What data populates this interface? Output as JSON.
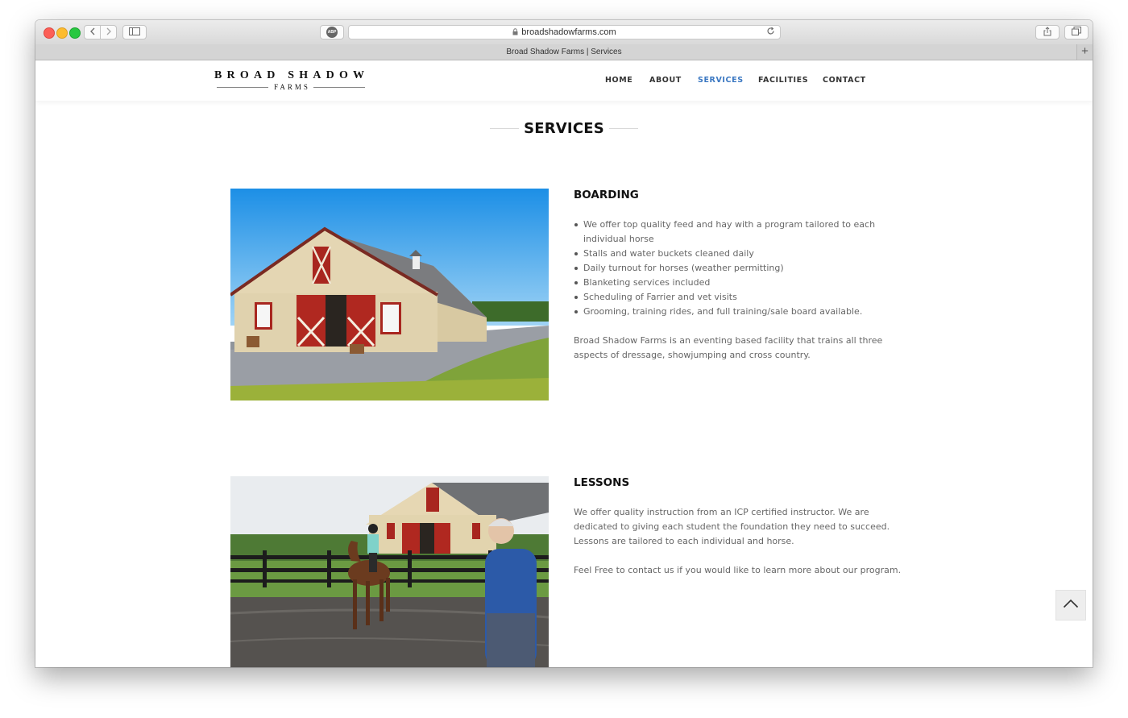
{
  "browser": {
    "url": "broadshadowfarms.com",
    "tab_title": "Broad Shadow Farms | Services",
    "abp_label": "ABP",
    "new_tab": "+"
  },
  "site": {
    "logo": {
      "main": "BROAD SHADOW",
      "sub": "FARMS"
    },
    "nav": [
      {
        "label": "HOME",
        "active": false
      },
      {
        "label": "ABOUT",
        "active": false
      },
      {
        "label": "SERVICES",
        "active": true
      },
      {
        "label": "FACILITIES",
        "active": false
      },
      {
        "label": "CONTACT",
        "active": false
      }
    ],
    "accent_color": "#3b78c2",
    "page_title": "SERVICES"
  },
  "sections": [
    {
      "title": "BOARDING",
      "bullets": [
        "We offer top quality feed and hay with a program tailored to each individual horse",
        "Stalls and water buckets cleaned daily",
        "Daily turnout for horses (weather permitting)",
        "Blanketing services included",
        "Scheduling of Farrier and vet visits",
        "Grooming, training rides, and full training/sale board available."
      ],
      "paragraphs": [
        "Broad Shadow Farms is an eventing based facility that trains all three aspects of dressage, showjumping and cross country."
      ],
      "image": "barn-photo"
    },
    {
      "title": "LESSONS",
      "bullets": [],
      "paragraphs": [
        "We offer quality instruction from an ICP certified instructor. We are dedicated to giving each student the foundation they need to succeed. Lessons are tailored to each individual and horse.",
        "Feel Free to contact us if you would like to learn more about our program."
      ],
      "image": "riding-lesson-photo"
    }
  ],
  "icons": {
    "back": "chevron-left-icon",
    "forward": "chevron-right-icon",
    "sidebar": "sidebar-icon",
    "lock": "lock-icon",
    "reload": "reload-icon",
    "share": "share-icon",
    "tabs": "tabs-icon",
    "back_to_top": "chevron-up-icon"
  }
}
